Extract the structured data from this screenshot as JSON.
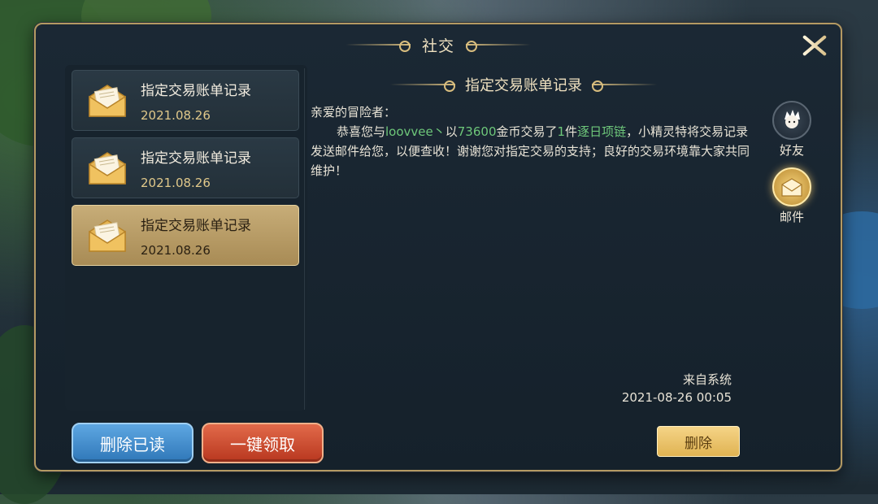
{
  "window": {
    "title": "社交"
  },
  "mail_list": [
    {
      "title": "指定交易账单记录",
      "date": "2021.08.26",
      "selected": false
    },
    {
      "title": "指定交易账单记录",
      "date": "2021.08.26",
      "selected": false
    },
    {
      "title": "指定交易账单记录",
      "date": "2021.08.26",
      "selected": true
    }
  ],
  "message": {
    "title": "指定交易账单记录",
    "greeting": "亲爱的冒险者：",
    "p1": "恭喜您与",
    "buyer": "loovvee丶",
    "p2": "以",
    "price": "73600",
    "p3": "金币交易了",
    "count": "1",
    "p4": "件",
    "item": "逐日项链",
    "p5": "，小精灵特将交易记录发送邮件给您，以便查收！谢谢您对指定交易的支持；良好的交易环境靠大家共同维护！",
    "sender": "来自系统",
    "timestamp": "2021-08-26  00:05"
  },
  "buttons": {
    "delete_read": "删除已读",
    "claim_all": "一键领取",
    "delete": "删除"
  },
  "side_tabs": [
    {
      "label": "好友",
      "icon": "friend-avatar-icon",
      "active": false
    },
    {
      "label": "邮件",
      "icon": "mail-icon",
      "active": true
    }
  ],
  "colors": {
    "highlight_green": "#6ec77a",
    "gold_border": "#b49a62",
    "selected_item": "#c7ad78"
  }
}
